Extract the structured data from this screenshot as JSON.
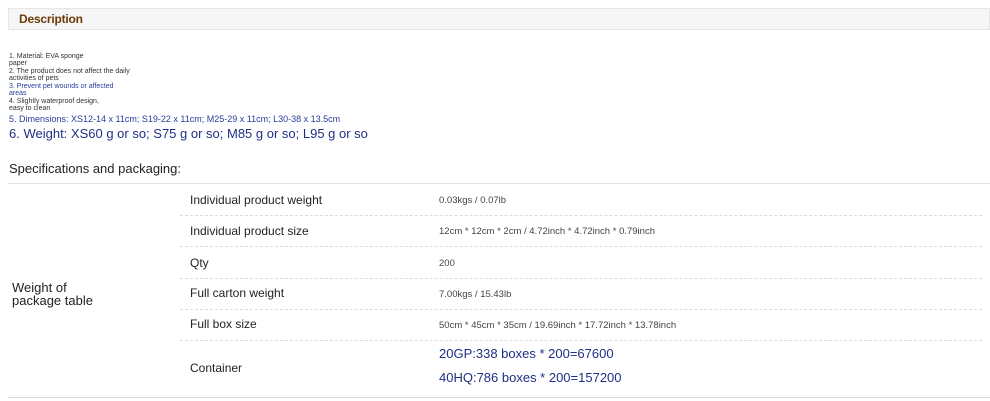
{
  "description": {
    "title": "Description",
    "lines": [
      "1. Material: EVA sponge\npaper",
      "2. The product does not affect the daily\nactivities of pets",
      "3. Prevent pet wounds or affected\nareas",
      "4. Slightly waterproof design,\neasy to clean",
      "5. Dimensions: XS12-14 x 11cm; S19-22 x 11cm; M25-29 x 11cm; L30-38 x 13.5cm",
      "6. Weight: XS60 g or so; S75 g or so; M85 g or so; L95 g or so"
    ]
  },
  "specs": {
    "title": "Specifications and packaging:",
    "group_label": "Weight of\npackage table",
    "rows": [
      {
        "name": "Individual product weight",
        "value": "0.03kgs / 0.07lb"
      },
      {
        "name": "Individual product size",
        "value": "12cm * 12cm * 2cm / 4.72inch * 4.72inch * 0.79inch"
      },
      {
        "name": "Qty",
        "value": "200"
      },
      {
        "name": "Full carton weight",
        "value": "7.00kgs / 15.43lb"
      },
      {
        "name": "Full box size",
        "value": "50cm * 45cm * 35cm / 19.69inch * 17.72inch * 13.78inch"
      },
      {
        "name": "Container",
        "values": [
          "20GP:338 boxes * 200=67600",
          "40HQ:786 boxes * 200=157200"
        ]
      }
    ]
  }
}
